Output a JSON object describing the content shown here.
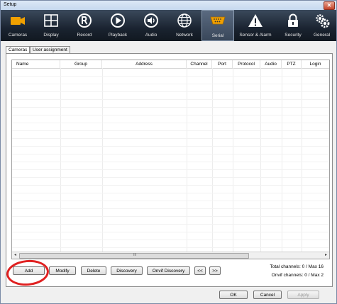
{
  "window": {
    "title": "Setup",
    "close_label": "✕"
  },
  "toolbar": {
    "items": [
      {
        "label": "Cameras",
        "icon": "camera-icon"
      },
      {
        "label": "Display",
        "icon": "display-grid-icon"
      },
      {
        "label": "Record",
        "icon": "record-icon"
      },
      {
        "label": "Playback",
        "icon": "playback-icon"
      },
      {
        "label": "Audio",
        "icon": "audio-icon"
      },
      {
        "label": "Network",
        "icon": "network-globe-icon"
      },
      {
        "label": "Serial",
        "icon": "serial-port-icon"
      },
      {
        "label": "Sensor & Alarm",
        "icon": "alarm-warning-icon"
      },
      {
        "label": "Security",
        "icon": "lock-icon"
      },
      {
        "label": "General",
        "icon": "gears-icon"
      }
    ],
    "selected": "Serial",
    "accent": "#f0a000"
  },
  "tabs": [
    {
      "label": "Cameras",
      "active": true
    },
    {
      "label": "User assignment",
      "active": false
    }
  ],
  "table": {
    "columns": [
      "Name",
      "Group",
      "Address",
      "Channel",
      "Port",
      "Protocol",
      "Audio",
      "PTZ",
      "Login"
    ],
    "rows": []
  },
  "buttons": {
    "add": "Add",
    "modify": "Modify",
    "delete": "Delete",
    "discovery": "Discovery",
    "onvif_discovery": "Onvif Discovery",
    "prev": "<<",
    "next": ">>",
    "ok": "OK",
    "cancel": "Cancel",
    "apply": "Apply"
  },
  "status": {
    "total_channels": "Total channels: 0 / Max 16",
    "onvif_channels": "Onvif channels: 0 / Max 2"
  },
  "scrollbar": {
    "left": "◂",
    "right": "▸",
    "grip": "III"
  },
  "annotation_color": "#e02020"
}
